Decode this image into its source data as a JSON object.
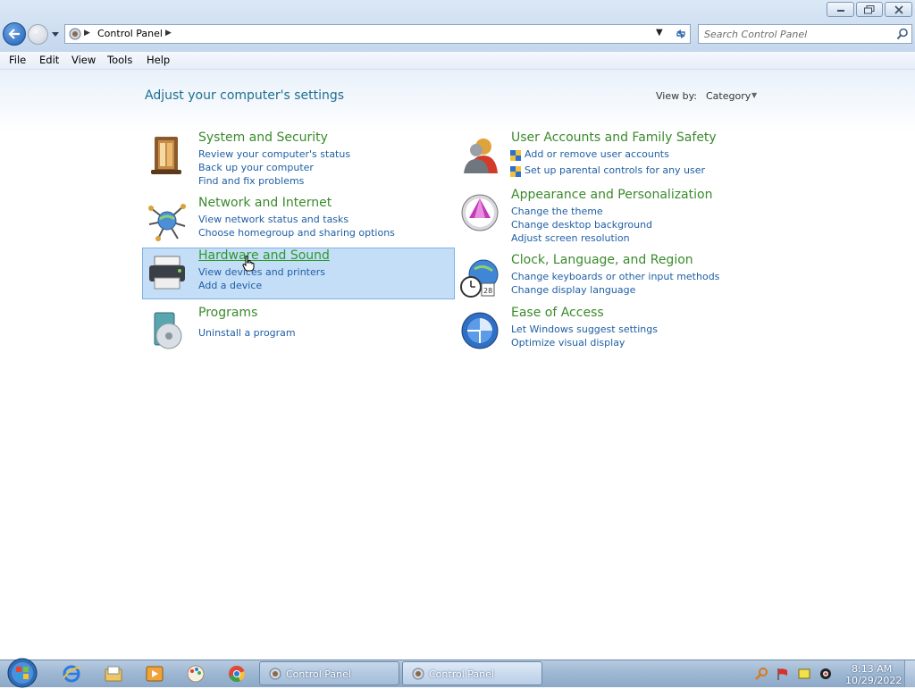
{
  "window": {
    "controls": {
      "minimize": "minimize",
      "maximize": "restore",
      "close": "close"
    }
  },
  "address": {
    "path": "Control Panel",
    "search_placeholder": "Search Control Panel"
  },
  "menubar": [
    "File",
    "Edit",
    "View",
    "Tools",
    "Help"
  ],
  "main": {
    "title": "Adjust your computer's settings",
    "view_by_label": "View by:",
    "view_by_value": "Category"
  },
  "categories": [
    {
      "title": "System and Security",
      "links": [
        "Review your computer's status",
        "Back up your computer",
        "Find and fix problems"
      ]
    },
    {
      "title": "Network and Internet",
      "links": [
        "View network status and tasks",
        "Choose homegroup and sharing options"
      ]
    },
    {
      "title": "Hardware and Sound",
      "links": [
        "View devices and printers",
        "Add a device"
      ]
    },
    {
      "title": "Programs",
      "links": [
        "Uninstall a program"
      ]
    },
    {
      "title": "User Accounts and Family Safety",
      "links": [
        "Add or remove user accounts",
        "Set up parental controls for any user"
      ]
    },
    {
      "title": "Appearance and Personalization",
      "links": [
        "Change the theme",
        "Change desktop background",
        "Adjust screen resolution"
      ]
    },
    {
      "title": "Clock, Language, and Region",
      "links": [
        "Change keyboards or other input methods",
        "Change display language"
      ]
    },
    {
      "title": "Ease of Access",
      "links": [
        "Let Windows suggest settings",
        "Optimize visual display"
      ]
    }
  ],
  "taskbar": {
    "tasks": [
      "Control Panel",
      "Control Panel"
    ],
    "clock_time": "8:13 AM",
    "clock_date": "10/29/2022"
  },
  "colors": {
    "category_title": "#3a8a2c",
    "link": "#1f5fa5",
    "hover_bg": "#c4def7"
  }
}
